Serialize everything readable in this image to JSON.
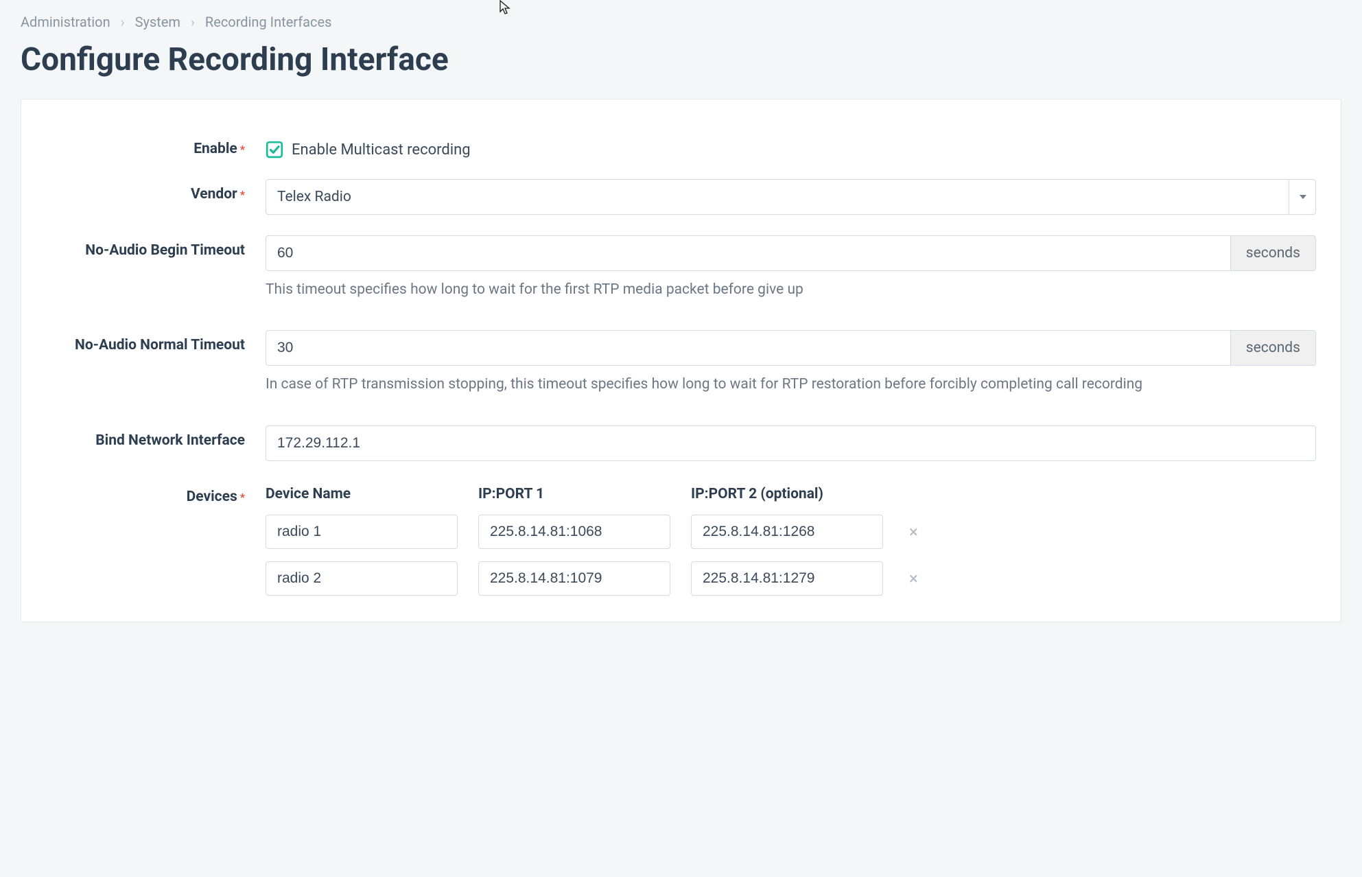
{
  "breadcrumb": {
    "items": [
      "Administration",
      "System",
      "Recording Interfaces"
    ]
  },
  "page_title": "Configure Recording Interface",
  "form": {
    "enable": {
      "label": "Enable",
      "required": true,
      "checkbox_label": "Enable Multicast recording",
      "checked": true
    },
    "vendor": {
      "label": "Vendor",
      "required": true,
      "value": "Telex Radio"
    },
    "noaudio_begin": {
      "label": "No-Audio Begin Timeout",
      "value": "60",
      "unit": "seconds",
      "help": "This timeout specifies how long to wait for the first RTP media packet before give up"
    },
    "noaudio_normal": {
      "label": "No-Audio Normal Timeout",
      "value": "30",
      "unit": "seconds",
      "help": "In case of RTP transmission stopping, this timeout specifies how long to wait for RTP restoration before forcibly completing call recording"
    },
    "bind_interface": {
      "label": "Bind Network Interface",
      "value": "172.29.112.1"
    },
    "devices": {
      "label": "Devices",
      "required": true,
      "headers": {
        "name": "Device Name",
        "ip1": "IP:PORT 1",
        "ip2": "IP:PORT 2 (optional)"
      },
      "rows": [
        {
          "name": "radio 1",
          "ip1": "225.8.14.81:1068",
          "ip2": "225.8.14.81:1268"
        },
        {
          "name": "radio 2",
          "ip1": "225.8.14.81:1079",
          "ip2": "225.8.14.81:1279"
        }
      ]
    }
  }
}
